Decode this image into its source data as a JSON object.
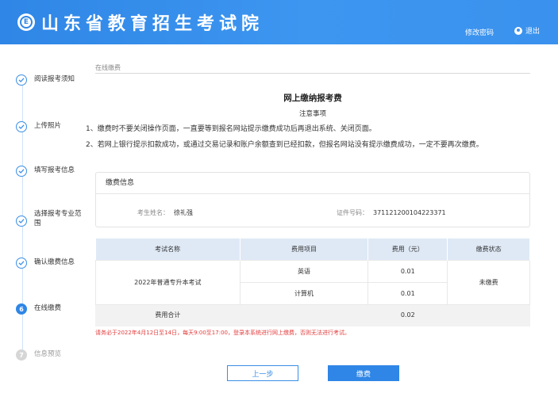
{
  "header": {
    "title": "山东省教育招生考试院",
    "change_password": "修改密码",
    "logout": "退出"
  },
  "steps": [
    {
      "label": "阅读报考须知",
      "state": "done"
    },
    {
      "label": "上传照片",
      "state": "done"
    },
    {
      "label": "填写报考信息",
      "state": "done"
    },
    {
      "label": "选择报考专业范围",
      "state": "done"
    },
    {
      "label": "确认缴费信息",
      "state": "done"
    },
    {
      "label": "在线缴费",
      "state": "active",
      "number": "6"
    },
    {
      "label": "信息预览",
      "state": "todo",
      "number": "7"
    }
  ],
  "breadcrumb": "在线缴费",
  "page_title": "网上缴纳报考费",
  "notice": {
    "title": "注意事项",
    "items": [
      "1、缴费时不要关闭操作页面，一直要等到报名网站提示缴费成功后再退出系统、关闭页面。",
      "2、若网上银行提示扣款成功，或通过交易记录和账户余额查到已经扣款，但报名网站没有提示缴费成功，一定不要再次缴费。"
    ]
  },
  "payment_info": {
    "heading": "缴费信息",
    "name_label": "考生姓名：",
    "name_value": "徐礼强",
    "id_label": "证件号码：",
    "id_value": "371121200104223371"
  },
  "fee_table": {
    "headers": [
      "考试名称",
      "费用项目",
      "费用（元）",
      "缴费状态"
    ],
    "exam_name": "2022年普通专升本考试",
    "rows": [
      {
        "item": "英语",
        "fee": "0.01"
      },
      {
        "item": "计算机",
        "fee": "0.01"
      }
    ],
    "status": "未缴费",
    "total_label": "费用合计",
    "total_value": "0.02"
  },
  "warning": "请务必于2022年4月12日至14日，每天9:00至17:00，登录本系统进行网上缴费，否则无法进行考试。",
  "buttons": {
    "prev": "上一步",
    "pay": "缴费"
  },
  "colors": {
    "primary": "#2f86e6",
    "warning": "#e23d3d",
    "table_header": "#dfe9f6"
  }
}
